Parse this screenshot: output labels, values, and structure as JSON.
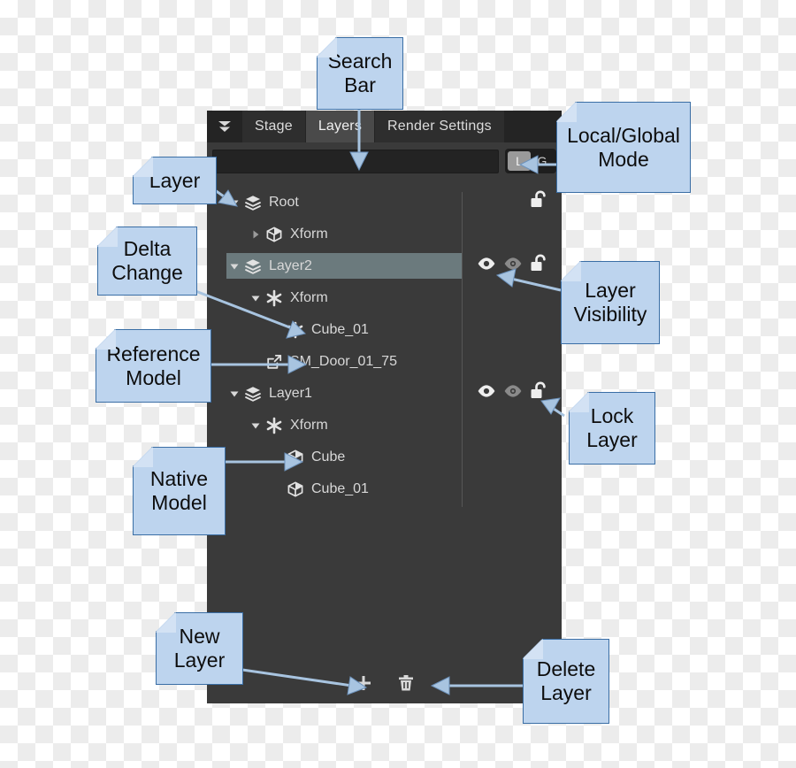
{
  "panel": {
    "menu_icon": "double-chevron-down-icon",
    "tabs": [
      {
        "label": "Stage",
        "active": false
      },
      {
        "label": "Layers",
        "active": true
      },
      {
        "label": "Render Settings",
        "active": false
      }
    ],
    "search": {
      "value": "",
      "placeholder": ""
    },
    "mode_toggle": {
      "options": [
        "L",
        "G"
      ],
      "selected": "L"
    },
    "tree": [
      {
        "indent": 0,
        "twisty": "down",
        "icon": "layers-stack-icon",
        "label": "Root",
        "selected": false,
        "visibility": null,
        "locked": "unlocked"
      },
      {
        "indent": 1,
        "twisty": "right",
        "icon": "cube-icon",
        "label": "Xform",
        "selected": false,
        "visibility": null,
        "locked": null
      },
      {
        "indent": 0,
        "twisty": "down",
        "icon": "layers-stack-icon",
        "label": "Layer2",
        "selected": true,
        "visibility": "visible",
        "locked": "unlocked"
      },
      {
        "indent": 1,
        "twisty": "down",
        "icon": "asterisk-delta-icon",
        "label": "Xform",
        "selected": false,
        "visibility": null,
        "locked": null
      },
      {
        "indent": 2,
        "twisty": "none",
        "icon": "asterisk-delta-icon",
        "label": "Cube_01",
        "selected": false,
        "visibility": null,
        "locked": null
      },
      {
        "indent": 1,
        "twisty": "none",
        "icon": "external-link-reference-icon",
        "label": "SM_Door_01_75",
        "selected": false,
        "visibility": null,
        "locked": null
      },
      {
        "indent": 0,
        "twisty": "down",
        "icon": "layers-stack-icon",
        "label": "Layer1",
        "selected": false,
        "visibility": "visible",
        "locked": "unlocked"
      },
      {
        "indent": 1,
        "twisty": "down",
        "icon": "asterisk-delta-icon",
        "label": "Xform",
        "selected": false,
        "visibility": null,
        "locked": null
      },
      {
        "indent": 2,
        "twisty": "none",
        "icon": "cube-icon",
        "label": "Cube",
        "selected": false,
        "visibility": null,
        "locked": null
      },
      {
        "indent": 2,
        "twisty": "none",
        "icon": "cube-icon",
        "label": "Cube_01",
        "selected": false,
        "visibility": null,
        "locked": null
      }
    ],
    "bottom_bar": {
      "add_label": "+",
      "add_icon": "plus-icon",
      "delete_icon": "trash-icon"
    }
  },
  "annotations": [
    {
      "id": "search-bar",
      "text": "Search Bar"
    },
    {
      "id": "local-global-mode",
      "text": "Local/Global Mode"
    },
    {
      "id": "layer",
      "text": "Layer"
    },
    {
      "id": "delta-change",
      "text": "Delta Change"
    },
    {
      "id": "reference-model",
      "text": "Reference Model"
    },
    {
      "id": "native-model",
      "text": "Native Model"
    },
    {
      "id": "layer-visibility",
      "text": "Layer Visibility"
    },
    {
      "id": "lock-layer",
      "text": "Lock Layer"
    },
    {
      "id": "new-layer",
      "text": "New Layer"
    },
    {
      "id": "delete-layer",
      "text": "Delete Layer"
    }
  ],
  "colors": {
    "panel_bg": "#3a3a3a",
    "tabbar_bg": "#242424",
    "tab_active": "#4a4a4a",
    "selection": "#6b7a7d",
    "note_fill": "#bdd4ee",
    "note_border": "#3a6ea5",
    "arrow": "#a8c4e0"
  }
}
